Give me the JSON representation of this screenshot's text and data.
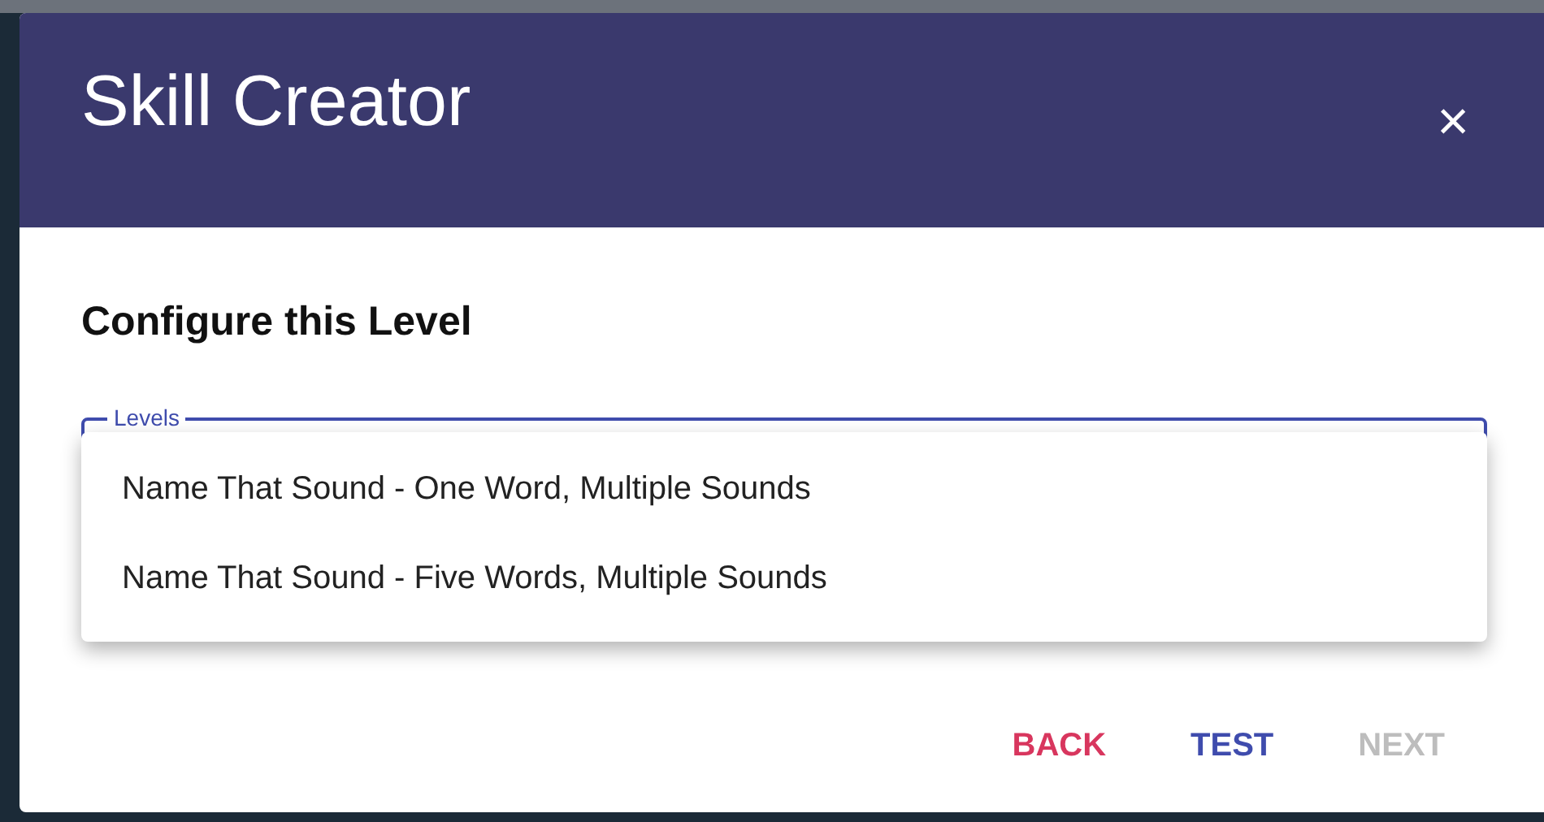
{
  "dialog": {
    "title": "Skill Creator",
    "close": "×"
  },
  "section_title": "Configure this Level",
  "field": {
    "label": "Levels"
  },
  "menu": {
    "items": [
      {
        "label": "Name That Sound - One Word, Multiple Sounds",
        "selected": false
      },
      {
        "label": "Name That Sound - Five Words, Multiple Sounds",
        "selected": false
      }
    ]
  },
  "buttons": [
    {
      "label": "BACK",
      "kind": "warn",
      "disabled": false
    },
    {
      "label": "TEST",
      "kind": "primary",
      "disabled": false
    },
    {
      "label": "NEXT",
      "kind": "primary",
      "disabled": true
    }
  ]
}
